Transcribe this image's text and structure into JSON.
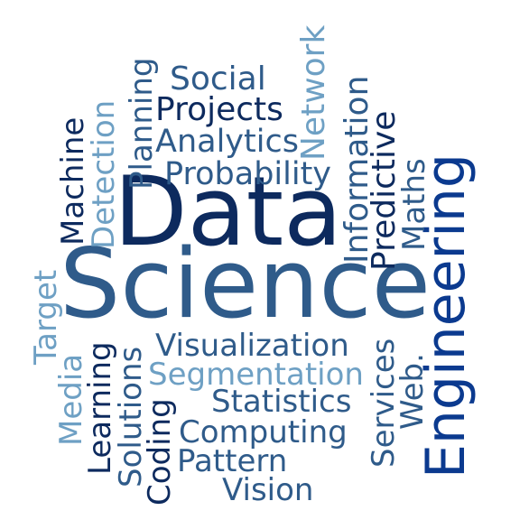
{
  "colors": {
    "navy": "#0d2a5e",
    "blue": "#0b3a8f",
    "steel": "#2f5b8a",
    "sky": "#6ea0c4"
  },
  "words": {
    "data": "Data",
    "science": "Science",
    "engineering": "Engineering",
    "social": "Social",
    "projects": "Projects",
    "analytics": "Analytics",
    "probability": "Probability",
    "network": "Network",
    "information": "Information",
    "predictive": "Predictive",
    "maths": "Maths",
    "planning": "Planning",
    "detection": "Detection",
    "machine": "Machine",
    "target": "Target",
    "media": "Media",
    "learning": "Learning",
    "solutions": "Solutions",
    "coding": "Coding",
    "visualization": "Visualization",
    "segmentation": "Segmentation",
    "statistics": "Statistics",
    "computing": "Computing",
    "pattern": "Pattern",
    "vision": "Vision",
    "services": "Services",
    "web": "Web."
  }
}
